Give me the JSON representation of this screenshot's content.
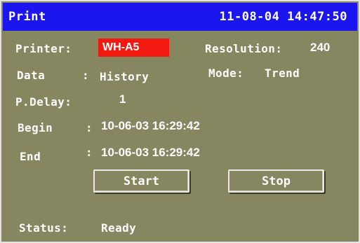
{
  "header": {
    "title": "Print",
    "datetime": "11-08-04 14:47:50"
  },
  "printer": {
    "label": "Printer:",
    "value": "WH-A5"
  },
  "resolution": {
    "label": "Resolution:",
    "value": "240"
  },
  "data": {
    "label": "Data",
    "separator": ":",
    "value": "History"
  },
  "mode": {
    "label": "Mode:",
    "value": "Trend"
  },
  "p_delay": {
    "label": "P.Delay:",
    "value": "1"
  },
  "begin": {
    "label": "Begin",
    "separator": ":",
    "value": "10-06-03 16:29:42"
  },
  "end": {
    "label": "End",
    "separator": ":",
    "value": "10-06-03 16:29:42"
  },
  "buttons": {
    "start": "Start",
    "stop": "Stop"
  },
  "status": {
    "label": "Status:",
    "value": "Ready"
  },
  "colors": {
    "title_bar": "#1b16ef",
    "background": "#868660",
    "printer_highlight": "#f21a10"
  }
}
